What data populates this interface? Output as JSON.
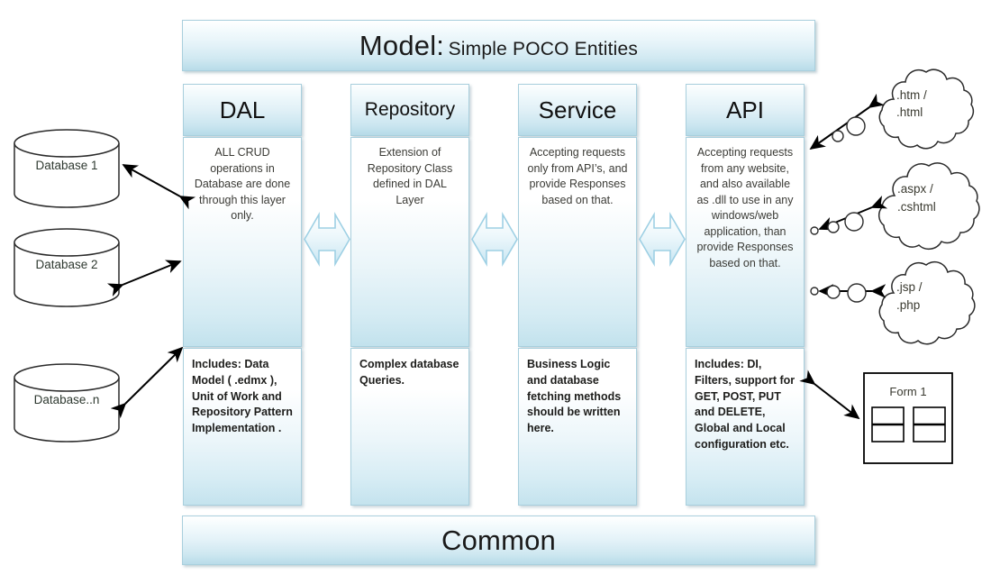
{
  "diagram": {
    "title_banner": {
      "primary": "Model:",
      "secondary": "Simple POCO Entities"
    },
    "bottom_banner": {
      "label": "Common"
    },
    "columns": [
      {
        "id": "dal",
        "title": "DAL",
        "description": "ALL CRUD operations in Database are done through this layer only.",
        "includes": "Includes: Data Model ( .edmx ), Unit of Work and Repository Pattern Implementation ."
      },
      {
        "id": "repository",
        "title": "Repository",
        "description": "Extension of Repository Class defined in DAL Layer",
        "includes": "Complex database Queries."
      },
      {
        "id": "service",
        "title": "Service",
        "description": "Accepting requests only from API’s, and provide Responses based on that.",
        "includes": "Business Logic and database fetching methods should be written here."
      },
      {
        "id": "api",
        "title": "API",
        "description": "Accepting requests from any website, and also available as .dll to use in any windows/web application, than provide Responses based on that.",
        "includes": "Includes: DI, Filters, support for GET,  POST, PUT and DELETE,  Global and Local configuration etc."
      }
    ],
    "databases": [
      {
        "id": "db1",
        "label": "Database 1"
      },
      {
        "id": "db2",
        "label": "Database 2"
      },
      {
        "id": "dbn",
        "label": "Database..n"
      }
    ],
    "clouds": [
      {
        "id": "cloud-html",
        "line1": ".htm /",
        "line2": ".html"
      },
      {
        "id": "cloud-aspx",
        "line1": ".aspx /",
        "line2": ".cshtml"
      },
      {
        "id": "cloud-jsp",
        "line1": ".jsp /",
        "line2": ".php"
      }
    ],
    "form": {
      "label": "Form 1"
    },
    "connectors": [
      {
        "id": "dal-repository",
        "kind": "double-arrow"
      },
      {
        "id": "repository-service",
        "kind": "double-arrow"
      },
      {
        "id": "service-api",
        "kind": "double-arrow"
      }
    ],
    "colors": {
      "accent_border": "#a9cfdd",
      "fill_light": "#ffffff",
      "fill_blue": "#b8dce9",
      "arrow_stroke": "#000000",
      "shape_stroke": "#2b2b2b",
      "connector_fill": "#d8eef7",
      "connector_stroke": "#9fd0e4"
    }
  }
}
